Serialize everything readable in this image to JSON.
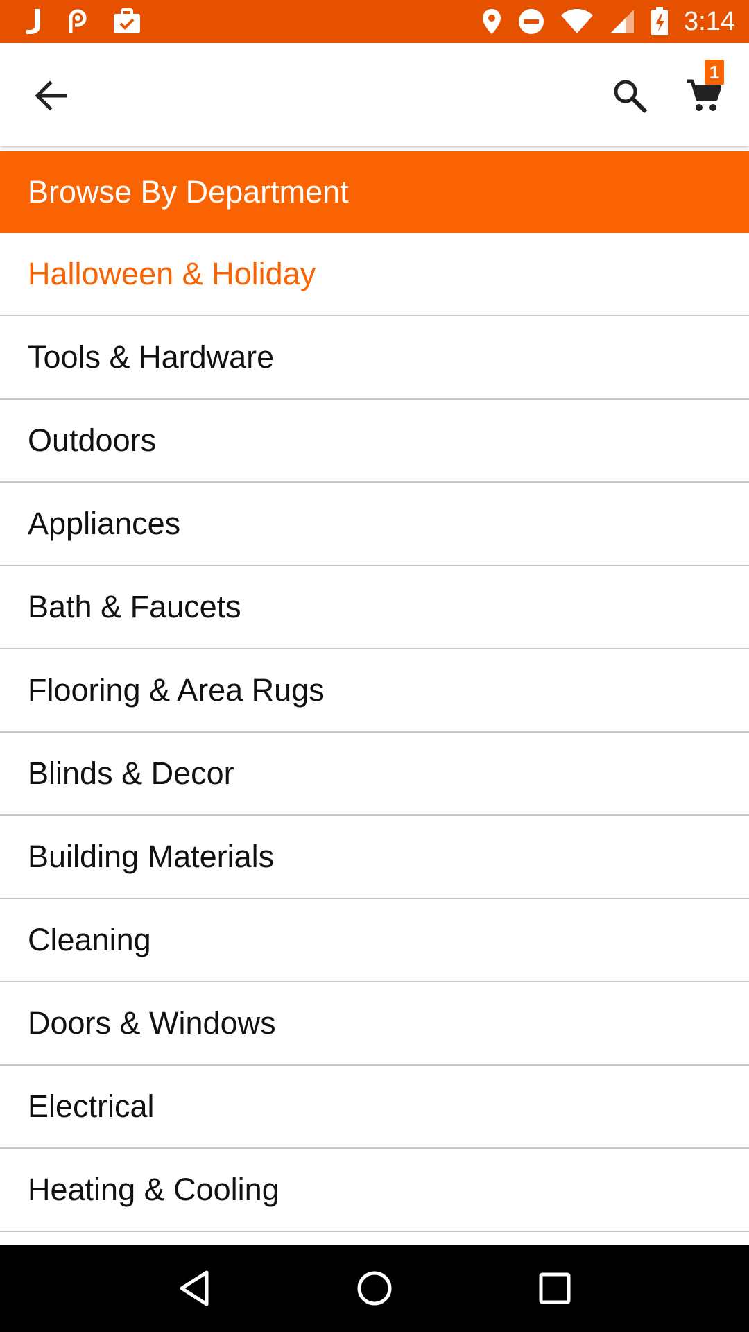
{
  "status_bar": {
    "time": "3:14",
    "left_icons": [
      "j-app-icon",
      "link-app-icon",
      "briefcase-check-icon"
    ],
    "right_icons": [
      "location-icon",
      "do-not-disturb-icon",
      "wifi-icon",
      "cell-signal-icon",
      "battery-charging-icon"
    ],
    "background": "#e65100"
  },
  "app_bar": {
    "cart_count": "1"
  },
  "department": {
    "header_title": "Browse By Department",
    "items": [
      {
        "label": "Halloween & Holiday",
        "active": true
      },
      {
        "label": "Tools & Hardware"
      },
      {
        "label": "Outdoors"
      },
      {
        "label": "Appliances"
      },
      {
        "label": "Bath & Faucets"
      },
      {
        "label": "Flooring & Area Rugs"
      },
      {
        "label": "Blinds & Decor"
      },
      {
        "label": "Building Materials"
      },
      {
        "label": "Cleaning"
      },
      {
        "label": "Doors & Windows"
      },
      {
        "label": "Electrical"
      },
      {
        "label": "Heating & Cooling"
      }
    ]
  },
  "colors": {
    "accent": "#f96302",
    "divider": "#c7c7c7",
    "text": "#111111"
  }
}
